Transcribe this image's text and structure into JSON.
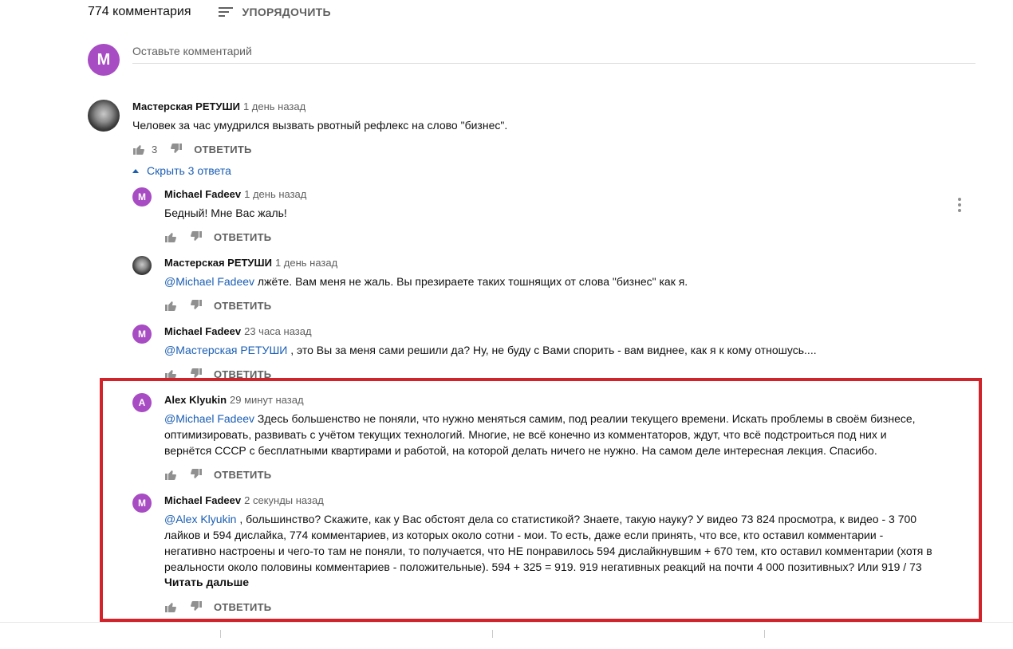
{
  "header": {
    "comment_count": "774 комментария",
    "sort_label": "УПОРЯДОЧИТЬ"
  },
  "new_comment": {
    "avatar_letter": "M",
    "placeholder": "Оставьте комментарий"
  },
  "reply_label": "ОТВЕТИТЬ",
  "top_comment": {
    "author": "Мастерская РЕТУШИ",
    "time": "1 день назад",
    "text": "Человек за час умудрился вызвать рвотный рефлекс на слово \"бизнес\".",
    "likes": "3"
  },
  "toggle_replies": "Скрыть 3 ответа",
  "replies": [
    {
      "author": "Michael Fadeev",
      "time": "1 день назад",
      "avatar_letter": "M",
      "mention": "",
      "text": "Бедный! Мне Вас жаль!"
    },
    {
      "author": "Мастерская РЕТУШИ",
      "time": "1 день назад",
      "avatar_letter": "",
      "mention": "@Michael Fadeev",
      "text": " лжёте. Вам меня не жаль. Вы презираете таких тошнящих от слова \"бизнес\" как я."
    },
    {
      "author": "Michael Fadeev",
      "time": "23 часа назад",
      "avatar_letter": "M",
      "mention": "@Мастерская РЕТУШИ",
      "text": " , это Вы за меня сами решили да? Ну, не буду с Вами спорить - вам виднее, как я к кому отношусь...."
    },
    {
      "author": "Alex Klyukin",
      "time": "29 минут назад",
      "avatar_letter": "A",
      "mention": "@Michael Fadeev",
      "lines": [
        " Здесь большенство не поняли, что нужно меняться самим, под реалии текущего времени. Искать проблемы в своём бизнесе,",
        "оптимизировать, развивать с учётом текущих технологий. Многие, не всё конечно из комментаторов, ждут, что всё подстроиться под них и",
        "вернётся СССР с бесплатными квартирами и работой, на которой делать ничего не нужно. На самом деле интересная лекция. Спасибо."
      ]
    },
    {
      "author": "Michael Fadeev",
      "time": "2 секунды назад",
      "avatar_letter": "M",
      "mention": "@Alex Klyukin",
      "lines": [
        " , большинство? Скажите, как у Вас обстоят дела со статистикой? Знаете, такую науку? У видео 73 824 просмотра, к видео - 3 700",
        "лайков и 594 дислайка, 774 комментариев, из которых около сотни - мои. То есть, даже если принять, что все, кто оставил комментарии -",
        "негативно настроены и чего-то там не поняли, то получается, что НЕ понравилось 594 дислайкнувшим + 670 тем, кто оставил комментарии (хотя в",
        "реальности около половины комментариев - положительные). 594 + 325 = 919. 919 негативных реакций на почти 4 000 позитивных? Или 919 / 73"
      ],
      "read_more": "Читать дальше"
    }
  ],
  "colors": {
    "avatar_purple": "#a74cc3",
    "link_blue": "#1a5eb4",
    "highlight_red": "#d2232a"
  }
}
